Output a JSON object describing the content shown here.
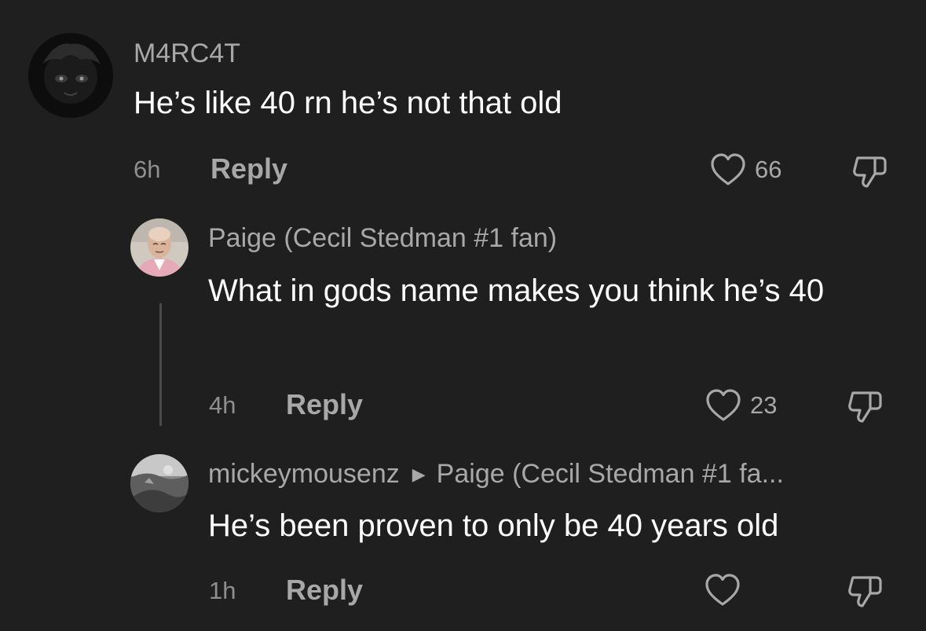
{
  "comments": [
    {
      "username": "M4RC4T",
      "text": "He’s like 40 rn he’s not that old",
      "time": "6h",
      "reply_label": "Reply",
      "likes": "66"
    },
    {
      "username": "Paige (Cecil Stedman #1 fan)",
      "text": "What in gods name makes you think he’s 40",
      "time": "4h",
      "reply_label": "Reply",
      "likes": "23"
    },
    {
      "username": "mickeymousenz",
      "reply_to": "Paige (Cecil Stedman #1 fa...",
      "text": "He’s been proven to only be 40 years old",
      "time": "1h",
      "reply_label": "Reply",
      "likes": ""
    }
  ],
  "icons": {
    "like": "heart-outline-icon",
    "dislike": "thumbs-down-outline-icon",
    "reply_caret": "caret-right-icon"
  },
  "colors": {
    "background": "#1f1f1f",
    "primary_text": "#ffffff",
    "secondary_text": "#a8a8a8",
    "muted_text": "#8f8f8f",
    "thread_line": "#4a4a4a"
  }
}
